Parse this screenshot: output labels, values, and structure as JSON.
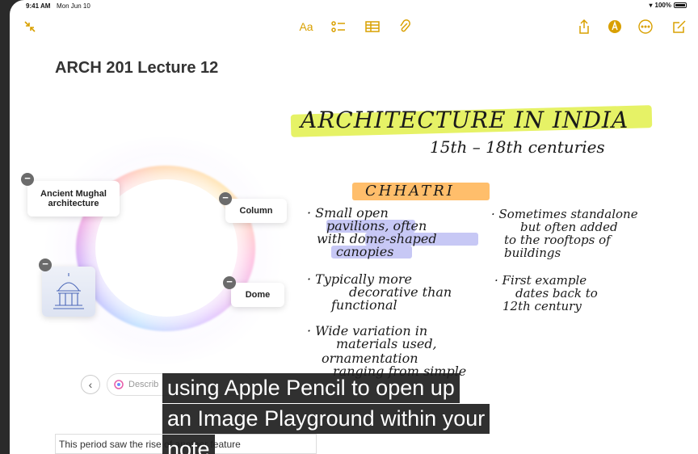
{
  "status": {
    "time": "9:41 AM",
    "date": "Mon Jun 10",
    "battery": "100%",
    "battery_level": 1.0
  },
  "icons": {
    "collapse": "collapse-arrows-icon",
    "format": "Aa",
    "checklist": "checklist-icon",
    "table": "table-icon",
    "attach": "paperclip-icon",
    "share": "share-icon",
    "pencil": "pencil-markup-icon",
    "more": "ellipsis-icon",
    "compose": "compose-icon"
  },
  "colors": {
    "accent": "#d9a000",
    "highlight_yellow": "#e6f266",
    "highlight_orange": "#ffbe6b",
    "highlight_lavender": "#c7c8f5"
  },
  "note": {
    "title": "ARCH 201 Lecture 12",
    "body_line": "This period saw the rise of another feature"
  },
  "playground": {
    "concepts": [
      "Ancient Mughal architecture",
      "Column",
      "Dome"
    ],
    "input_placeholder": "Describ"
  },
  "handwriting": {
    "heading": "ARCHITECTURE IN INDIA",
    "subheading": "15th – 18th centuries",
    "section": "CHHATRI",
    "col1": [
      "· Small open",
      "pavilions, often",
      "with dome-shaped",
      "canopies",
      "· Typically more",
      "decorative than",
      "functional",
      "· Wide variation in",
      "materials used,",
      "ornamentation",
      "ranging from simple"
    ],
    "col2": [
      "· Sometimes standalone",
      "but often added",
      "to the rooftops of",
      "buildings",
      "· First example",
      "dates back to",
      "12th century"
    ]
  },
  "caption": {
    "line1": "using Apple Pencil to open up",
    "line2": "an Image Playground within your",
    "line3": "note"
  }
}
